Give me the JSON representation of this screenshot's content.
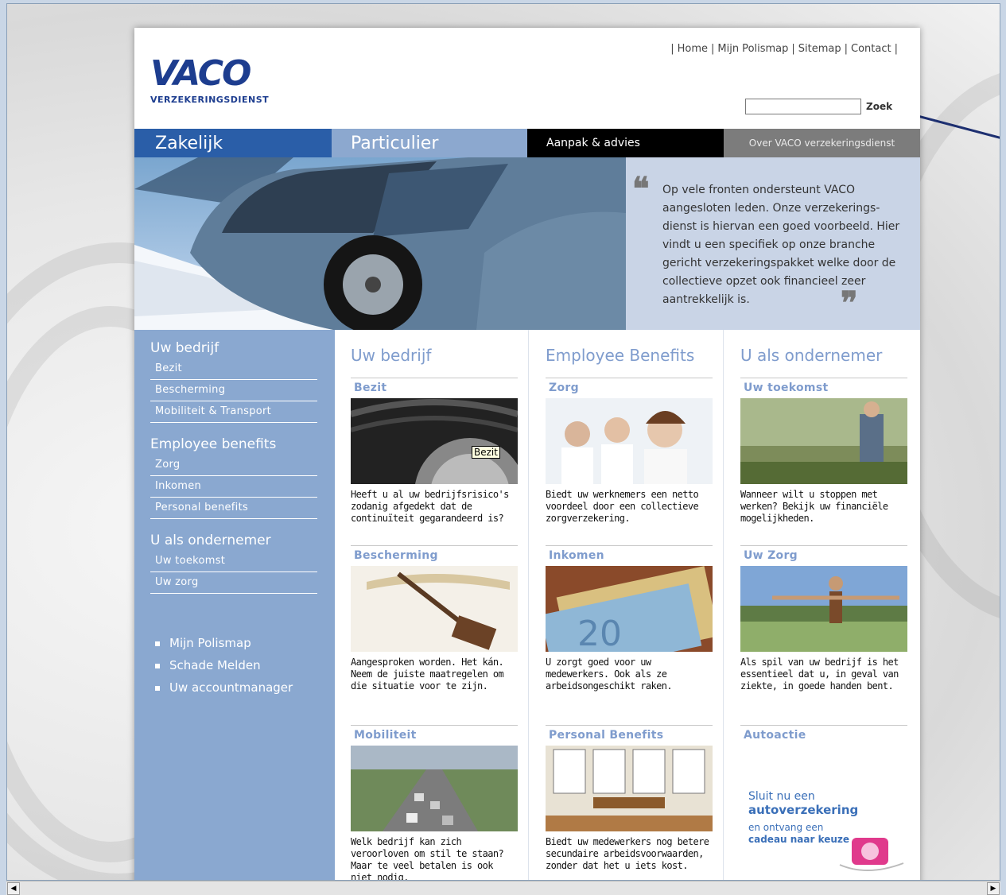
{
  "header": {
    "logo_word": "VACO",
    "logo_sub": "VERZEKERINGSDIENST",
    "toplinks": [
      "Home",
      "Mijn Polismap",
      "Sitemap",
      "Contact"
    ],
    "search_button": "Zoek",
    "search_value": ""
  },
  "nav": {
    "zakelijk": "Zakelijk",
    "particulier": "Particulier",
    "aanpak": "Aanpak & advies",
    "over": "Over VACO verzekeringsdienst"
  },
  "hero": {
    "quote": "Op vele fronten ondersteunt VACO aangesloten leden. Onze verzekerings-dienst is hiervan een goed voorbeeld. Hier vindt u een specifiek op onze branche gericht verzekeringspakket welke door de collectieve opzet ook financieel zeer aantrekkelijk is.",
    "open_mark": "❝",
    "close_mark": "❞"
  },
  "sidebar": {
    "sections": [
      {
        "title": "Uw bedrijf",
        "links": [
          "Bezit",
          "Bescherming",
          "Mobiliteit & Transport"
        ]
      },
      {
        "title": "Employee benefits",
        "links": [
          "Zorg",
          "Inkomen",
          "Personal benefits"
        ]
      },
      {
        "title": "U als ondernemer",
        "links": [
          "Uw toekomst",
          "Uw zorg"
        ]
      }
    ],
    "bullets": [
      "Mijn Polismap",
      "Schade Melden",
      "Uw accountmanager"
    ]
  },
  "columns": [
    {
      "title": "Uw bedrijf",
      "cards": [
        {
          "head": "Bezit",
          "text": "Heeft u al uw bedrijfsrisico's zodanig afgedekt dat de continuïteit gegarandeerd is?",
          "tooltip": "Bezit"
        },
        {
          "head": "Bescherming",
          "text": "Aangesproken worden. Het kán. Neem de juiste maatregelen om die situatie voor te zijn."
        },
        {
          "head": "Mobiliteit",
          "text": "Welk bedrijf kan zich veroorloven om stil te staan? Maar te veel betalen is ook niet nodig."
        }
      ]
    },
    {
      "title": "Employee Benefits",
      "cards": [
        {
          "head": "Zorg",
          "text": "Biedt uw werknemers een netto voordeel door een collectieve zorgverzekering."
        },
        {
          "head": "Inkomen",
          "text": "U zorgt goed voor uw medewerkers. Ook als ze arbeidsongeschikt raken."
        },
        {
          "head": "Personal Benefits",
          "text": "Biedt uw medewerkers nog betere secundaire arbeidsvoorwaarden, zonder dat het u iets kost."
        }
      ]
    },
    {
      "title": "U als ondernemer",
      "cards": [
        {
          "head": "Uw toekomst",
          "text": "Wanneer wilt u stoppen met werken? Bekijk uw financiële mogelijkheden."
        },
        {
          "head": "Uw Zorg",
          "text": "Als spil van uw bedrijf is het essentieel dat u, in geval van ziekte, in goede handen bent."
        },
        {
          "head": "Autoactie",
          "text": ""
        }
      ]
    }
  ],
  "promo": {
    "line1": "Sluit nu een",
    "line2": "autoverzekering",
    "line3": "en ontvang een",
    "line4": "cadeau naar keuze"
  },
  "colors": {
    "brand_blue": "#1d3d8f",
    "nav_zakelijk": "#2a5ea8",
    "nav_particulier": "#8ca8cf",
    "sidebar": "#8aa8d0",
    "heading_blue": "#7f9ccd",
    "quote_bg": "#c9d4e6"
  }
}
